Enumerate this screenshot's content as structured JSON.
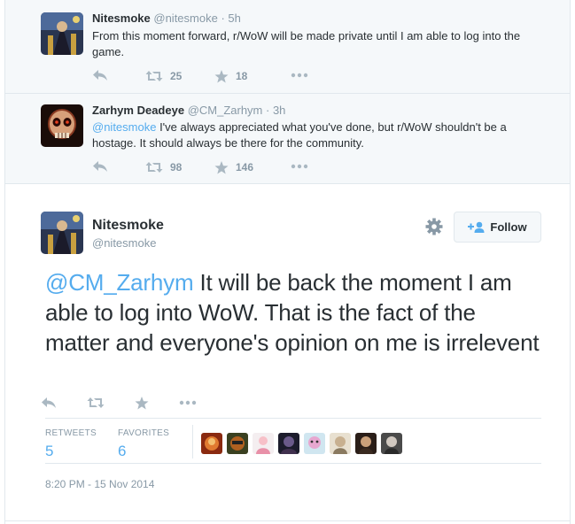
{
  "replies": [
    {
      "name": "Nitesmoke",
      "handle": "@nitesmoke",
      "time": "· 5h",
      "text": "From this moment forward, r/WoW will be made private until I am able to log into the game.",
      "retweets": "25",
      "favorites": "18"
    },
    {
      "name": "Zarhym Deadeye",
      "handle": "@CM_Zarhym",
      "time": "· 3h",
      "mention": "@nitesmoke",
      "text": " I've always appreciated what you've done, but r/WoW shouldn't be a hostage. It should always be there for the community.",
      "retweets": "98",
      "favorites": "146"
    }
  ],
  "main_tweet": {
    "name": "Nitesmoke",
    "handle": "@nitesmoke",
    "follow_label": "Follow",
    "mention": "@CM_Zarhym",
    "text": " It will be back the moment I am able to log into WoW.  That is the fact of the matter and everyone's opinion on me is irrelevent",
    "retweets_label": "RETWEETS",
    "retweets_value": "5",
    "favorites_label": "FAVORITES",
    "favorites_value": "6",
    "timestamp": "8:20 PM - 15 Nov 2014"
  },
  "colors": {
    "link": "#55acee",
    "muted": "#8899a6",
    "text": "#292f33",
    "reply_bg": "#f5f8fa"
  },
  "icons": [
    "reply-icon",
    "retweet-icon",
    "favorite-star-icon",
    "more-dots-icon",
    "gear-icon",
    "follow-person-icon"
  ]
}
